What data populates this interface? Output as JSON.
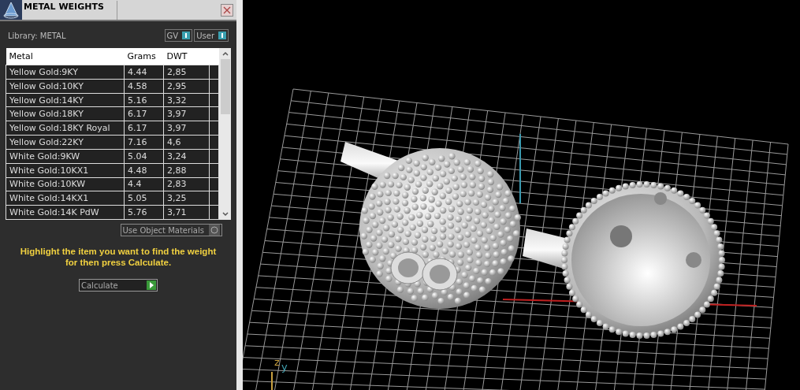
{
  "window": {
    "title": "METAL WEIGHTS"
  },
  "library": {
    "label": "Library: METAL"
  },
  "toggles": [
    {
      "label": "GV",
      "on": true
    },
    {
      "label": "User",
      "on": true
    }
  ],
  "table": {
    "columns": [
      "Metal",
      "Grams",
      "DWT"
    ],
    "rows": [
      {
        "cells": [
          "Yellow Gold:9KY",
          "4.44",
          "2,85"
        ]
      },
      {
        "cells": [
          "Yellow Gold:10KY",
          "4.58",
          "2,95"
        ]
      },
      {
        "cells": [
          "Yellow Gold:14KY",
          "5.16",
          "3,32"
        ]
      },
      {
        "cells": [
          "Yellow Gold:18KY",
          "6.17",
          "3,97"
        ]
      },
      {
        "cells": [
          "Yellow Gold:18KY Royal",
          "6.17",
          "3,97"
        ]
      },
      {
        "cells": [
          "Yellow Gold:22KY",
          "7.16",
          "4,6"
        ]
      },
      {
        "cells": [
          "White Gold:9KW",
          "5.04",
          "3,24"
        ]
      },
      {
        "cells": [
          "White Gold:10KX1",
          "4.48",
          "2,88"
        ]
      },
      {
        "cells": [
          "White Gold:10KW",
          "4.4",
          "2,83"
        ]
      },
      {
        "cells": [
          "White Gold:14KX1",
          "5.05",
          "3,25"
        ]
      },
      {
        "cells": [
          "White Gold:14K PdW",
          "5.76",
          "3,71"
        ]
      }
    ]
  },
  "use_object_materials": {
    "label": "Use Object Materials",
    "on": false
  },
  "hint": "Highlight the item you want to find the weight for then press Calculate.",
  "calculate": {
    "label": "Calculate"
  },
  "viewport": {
    "axes": [
      {
        "label": "z",
        "color": "#c8a040"
      },
      {
        "label": "y",
        "color": "#40a0b0"
      }
    ]
  }
}
